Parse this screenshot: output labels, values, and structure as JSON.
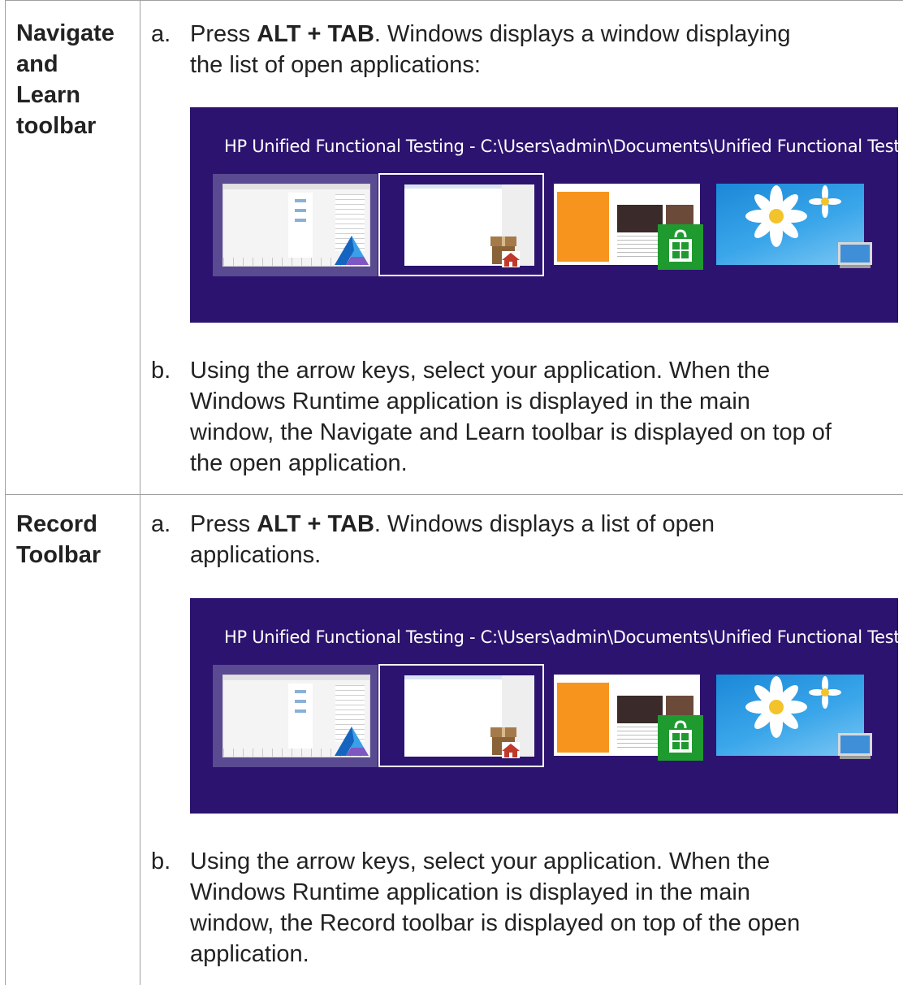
{
  "rows": [
    {
      "heading": [
        "Navigate",
        "and",
        "Learn",
        "toolbar"
      ],
      "step_a": {
        "letter": "a.",
        "text_before": "Press ",
        "keys": "ALT + TAB",
        "text_after_line1": ". Windows displays a window displaying",
        "text_line2": "the list of open applications:"
      },
      "switcher_title": "HP Unified Functional Testing - C:\\Users\\admin\\Documents\\Unified Functional Test...",
      "step_b": {
        "letter": "b.",
        "lines": [
          "Using the arrow keys, select your application. When the",
          "Windows Runtime application is displayed in the main",
          "window, the Navigate and Learn toolbar is displayed on top of",
          "the open application."
        ]
      }
    },
    {
      "heading": [
        "Record",
        "Toolbar"
      ],
      "step_a": {
        "letter": "a.",
        "text_before": "Press ",
        "keys": "ALT + TAB",
        "text_after_line1": ". Windows displays a list of open",
        "text_line2": "applications."
      },
      "switcher_title": "HP Unified Functional Testing - C:\\Users\\admin\\Documents\\Unified Functional Test...",
      "step_b": {
        "letter": "b.",
        "lines": [
          "Using the arrow keys, select your application. When the",
          "Windows Runtime application is displayed in the main",
          "window, the Record toolbar is displayed on top of the open",
          "application."
        ]
      }
    }
  ],
  "colors": {
    "switcher_background": "#2c136f",
    "grid_line": "#a0a0a0",
    "store_tile": "#f7941d",
    "store_badge": "#1f9a2f"
  },
  "icons": [
    "uft-logo-icon",
    "package-home-icon",
    "store-bag-icon",
    "desktop-monitor-icon"
  ]
}
